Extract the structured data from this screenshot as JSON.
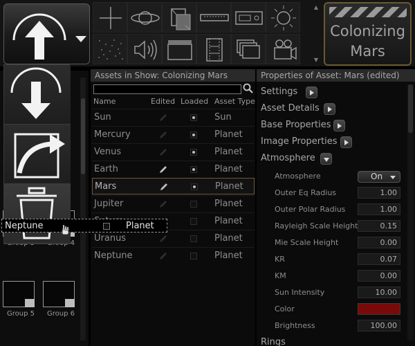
{
  "toolbar": {
    "main_button_icon": "upload-arrow-icon",
    "tools": [
      "crosshair-icon",
      "saturn-icon",
      "cube-icon",
      "ruler-icon",
      "projector-icon",
      "sun-icon",
      "starfield-icon",
      "speaker-icon",
      "clapper-icon",
      "film-strip-icon",
      "stack-icon",
      "camera-icon"
    ],
    "show_title_line1": "Colonizing",
    "show_title_line2": "Mars"
  },
  "menu": {
    "items": [
      "download-arrow-icon",
      "share-arrow-icon",
      "trash-icon"
    ]
  },
  "groups": {
    "items": [
      "Group 3",
      "Group 4",
      "Group 5",
      "Group 6"
    ]
  },
  "assets": {
    "header": "Assets in Show: Colonizing Mars",
    "columns": {
      "name": "Name",
      "edited": "Edited",
      "loaded": "Loaded",
      "type": "Asset Type"
    },
    "rows": [
      {
        "name": "Sun",
        "edited": false,
        "loaded": true,
        "type": "Sun"
      },
      {
        "name": "Mercury",
        "edited": false,
        "loaded": true,
        "type": "Planet"
      },
      {
        "name": "Venus",
        "edited": false,
        "loaded": true,
        "type": "Planet"
      },
      {
        "name": "Earth",
        "edited": true,
        "loaded": true,
        "type": "Planet"
      },
      {
        "name": "Mars",
        "edited": true,
        "loaded": true,
        "type": "Planet"
      },
      {
        "name": "Jupiter",
        "edited": false,
        "loaded": false,
        "type": "Planet"
      },
      {
        "name": "Saturn",
        "edited": false,
        "loaded": false,
        "type": "Planet"
      },
      {
        "name": "Uranus",
        "edited": false,
        "loaded": false,
        "type": "Planet"
      },
      {
        "name": "Neptune",
        "edited": false,
        "loaded": false,
        "type": "Planet"
      }
    ],
    "selected_index": 4
  },
  "drag": {
    "name": "Neptune",
    "type": "Planet"
  },
  "props": {
    "header": "Properties of Asset: Mars (edited)",
    "sections": {
      "settings": "Settings",
      "details": "Asset Details",
      "base": "Base Properties",
      "image": "Image Properties",
      "atmosphere": "Atmosphere",
      "rings": "Rings"
    },
    "atmosphere_label": "Atmosphere",
    "atmosphere_value": "On",
    "fields": [
      {
        "label": "Outer Eq Radius",
        "value": "1.00"
      },
      {
        "label": "Outer Polar Radius",
        "value": "1.00"
      },
      {
        "label": "Rayleigh Scale Height",
        "value": "0.15"
      },
      {
        "label": "Mie Scale Height",
        "value": "0.00"
      },
      {
        "label": "KR",
        "value": "0.07"
      },
      {
        "label": "KM",
        "value": "0.00"
      },
      {
        "label": "Sun Intensity",
        "value": "10.00"
      }
    ],
    "color_label": "Color",
    "color_value": "#7a0a0a",
    "brightness_label": "Brightness",
    "brightness_value": "100.00"
  }
}
